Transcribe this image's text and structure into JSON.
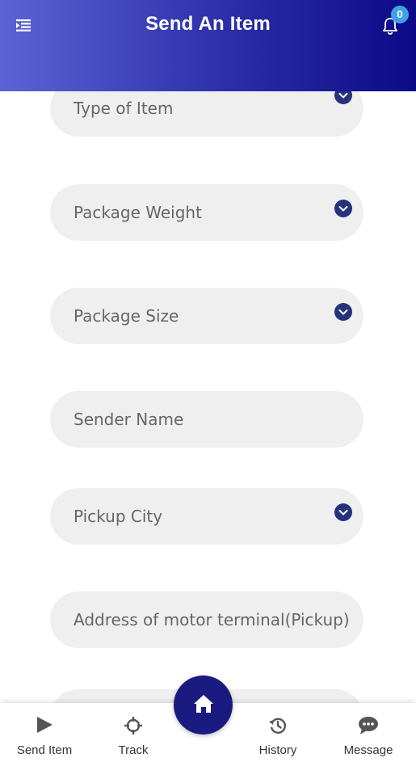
{
  "header": {
    "title": "Send An Item",
    "notification_count": "0",
    "menu_icon": "menu-icon",
    "bell_icon": "bell-icon"
  },
  "form": {
    "fields": [
      {
        "label": "Type of Item",
        "dropdown": true
      },
      {
        "label": "Package Weight",
        "dropdown": true
      },
      {
        "label": "Package Size",
        "dropdown": true
      },
      {
        "label": "Sender Name",
        "dropdown": false
      },
      {
        "label": "Pickup City",
        "dropdown": true
      },
      {
        "label": "Address of motor terminal(Pickup)",
        "dropdown": false
      }
    ]
  },
  "bottom_nav": {
    "items": [
      {
        "label": "Send Item",
        "icon": "play-icon"
      },
      {
        "label": "Track",
        "icon": "crosshair-icon"
      },
      {
        "label": "History",
        "icon": "history-icon"
      },
      {
        "label": "Message",
        "icon": "chat-icon"
      }
    ],
    "home_icon": "home-icon"
  },
  "colors": {
    "header_gradient_start": "#5b64d6",
    "header_gradient_end": "#0c0a86",
    "accent": "#1a1b80",
    "badge": "#3fa2e6",
    "field_bg": "#efefef",
    "chevron_bg": "#26327a"
  }
}
